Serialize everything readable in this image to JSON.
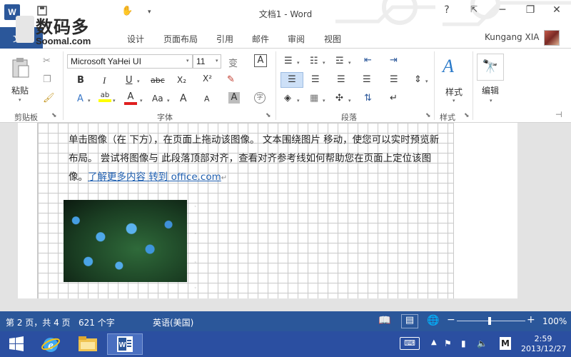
{
  "app": {
    "logo_letter": "W",
    "title": "文档1 - Word"
  },
  "qat": {
    "save_icon": "save-icon",
    "undo_icon": "undo-icon",
    "redo_icon": "redo-icon",
    "touch_icon": "touch-icon",
    "customize_icon": "customize-icon"
  },
  "window": {
    "help": "?",
    "restore_ribbon": "⇱",
    "minimize": "─",
    "maximize": "❐",
    "close": "✕"
  },
  "watermark": {
    "cn": "数码多",
    "en": "Soomal.com"
  },
  "tabs": {
    "file": "文件",
    "design": "设计",
    "layout": "页面布局",
    "references": "引用",
    "mailings": "邮件",
    "review": "审阅",
    "view": "视图"
  },
  "user": {
    "name": "Kungang XIA"
  },
  "ribbon": {
    "clipboard": {
      "label": "剪贴板",
      "paste": "粘贴"
    },
    "font": {
      "label": "字体",
      "name": "Microsoft YaHei UI",
      "size": "11",
      "bold": "B",
      "italic": "I",
      "underline": "U",
      "strike": "abc",
      "sub": "X₂",
      "sup": "X²",
      "wen": "变",
      "a_box": "A",
      "aa": "Aa",
      "grow": "A",
      "shrink": "A",
      "char_border": "A",
      "circle_char": "字"
    },
    "paragraph": {
      "label": "段落"
    },
    "styles": {
      "label": "样式",
      "button": "样式"
    },
    "editing": {
      "button": "编辑"
    }
  },
  "document": {
    "line1": "单击图像（在 下方），在页面上拖动该图像。 文本围绕图片 移动，使您可以实时预览新",
    "line2": "布局。 尝试将图像与 此段落顶部对齐，查看对齐参考线如何帮助您在页面上定位该图",
    "line3_prefix": "像。",
    "link_text": "了解更多内容 转到 office.com",
    "return_mark": "↵"
  },
  "status": {
    "page": "第 2 页，共 4 页",
    "words": "621 个字",
    "language": "英语(美国)",
    "zoom": "100%",
    "zoom_level_pct": 100
  },
  "taskbar": {
    "time": "2:59",
    "date": "2013/12/27",
    "ime": "M"
  },
  "colors": {
    "accent": "#2b579a",
    "taskbar": "#2b4fa1",
    "link": "#1f5fb0",
    "selected": "#cde0f7"
  }
}
